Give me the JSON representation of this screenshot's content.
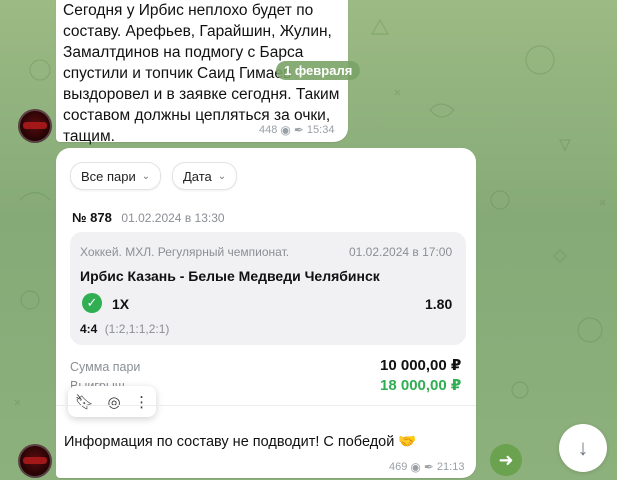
{
  "message1": {
    "lines": [
      "Сегодня у Ирбис неплохо будет по",
      "составу. Арефьев, Гарайшин, Жулин,",
      "Замалтдинов на подмогу с Барса",
      "спустили и топчик Саид Гимаев",
      "выздоровел и в заявке сегодня. Таким",
      "составом должны цепляться за очки,",
      "тащим."
    ],
    "views": "448",
    "time": "15:34"
  },
  "date_pill": "1 февраля",
  "bet": {
    "filters": [
      "Все пари",
      "Дата"
    ],
    "number": "№ 878",
    "created": "01.02.2024 в 13:30",
    "event_league": "Хоккей. МХЛ. Регулярный чемпионат.",
    "event_date": "01.02.2024 в 17:00",
    "teams": "Ирбис Казань - Белые Медведи Челябинск",
    "pick": "1X",
    "odds": "1.80",
    "score": "4:4",
    "periods": "(1:2,1:1,2:1)",
    "stake_label": "Сумма пари",
    "stake_value": "10 000,00 ₽",
    "win_label": "Выигрыш",
    "win_value": "18 000,00 ₽"
  },
  "message2": {
    "text": "Информация по составу не подводит! С победой 🤝",
    "views": "469",
    "time": "21:13"
  },
  "colors": {
    "accent_green": "#2fae52",
    "wallpaper": "#8db17c",
    "date_pill": "#7aa367"
  },
  "icons": {
    "eye": "eye-icon",
    "pin": "pin-icon",
    "bookmark": "bookmark-icon",
    "camera": "camera-icon",
    "more": "more-vertical-icon",
    "share": "arrow-right-icon",
    "scroll": "arrow-down-icon"
  }
}
